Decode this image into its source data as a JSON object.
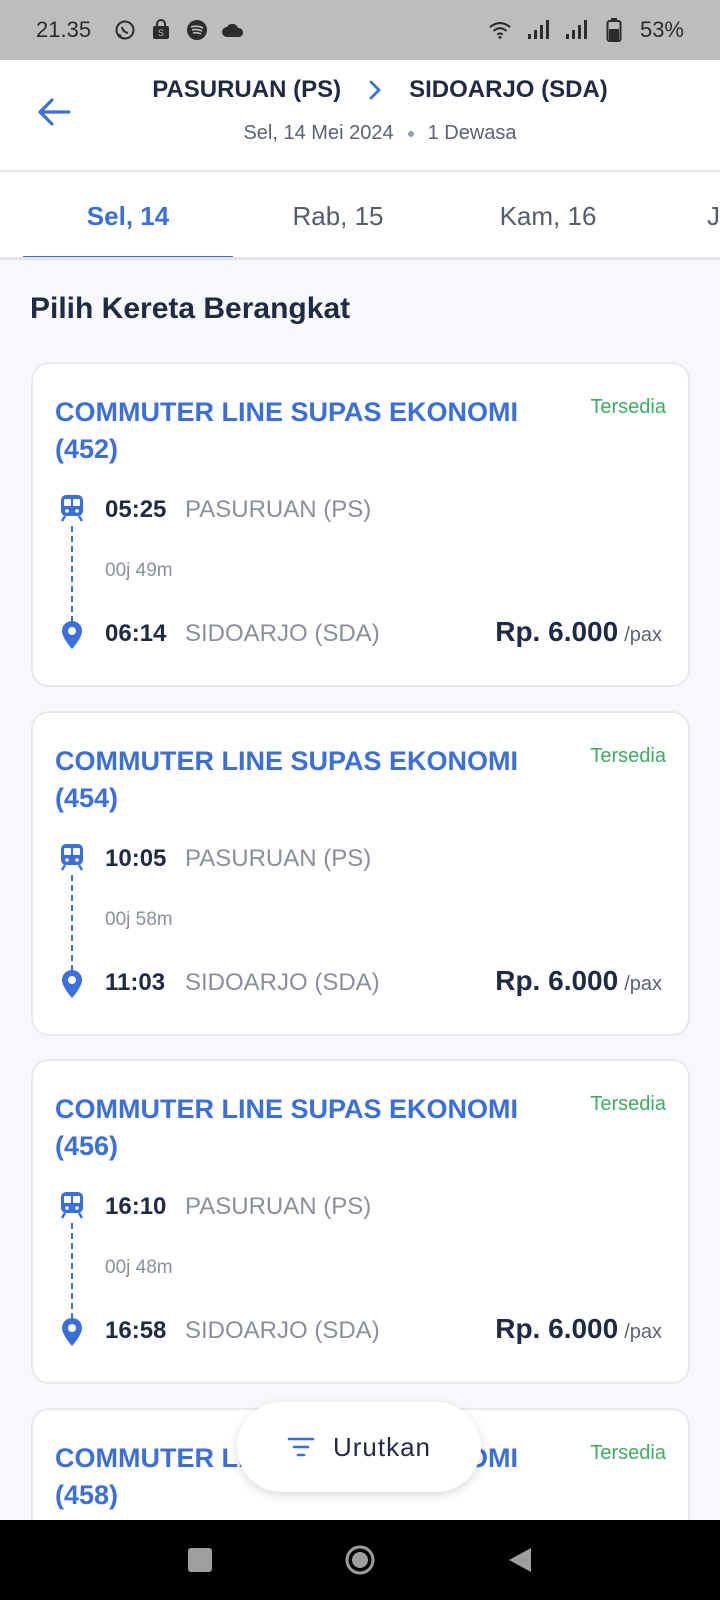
{
  "status": {
    "time": "21.35",
    "battery": "53%"
  },
  "header": {
    "origin": "PASURUAN (PS)",
    "destination": "SIDOARJO (SDA)",
    "date": "Sel, 14 Mei 2024",
    "passengers": "1 Dewasa"
  },
  "tabs": [
    {
      "label": "Sel, 14",
      "active": true
    },
    {
      "label": "Rab, 15",
      "active": false
    },
    {
      "label": "Kam, 16",
      "active": false
    },
    {
      "label": "J",
      "active": false
    }
  ],
  "section_title": "Pilih Kereta Berangkat",
  "trains": [
    {
      "name": "COMMUTER LINE SUPAS EKONOMI (452)",
      "availability": "Tersedia",
      "dep_time": "05:25",
      "dep_station": "PASURUAN (PS)",
      "duration": "00j 49m",
      "arr_time": "06:14",
      "arr_station": "SIDOARJO (SDA)",
      "price": "Rp. 6.000",
      "price_unit": "/pax"
    },
    {
      "name": "COMMUTER LINE SUPAS EKONOMI (454)",
      "availability": "Tersedia",
      "dep_time": "10:05",
      "dep_station": "PASURUAN (PS)",
      "duration": "00j 58m",
      "arr_time": "11:03",
      "arr_station": "SIDOARJO (SDA)",
      "price": "Rp. 6.000",
      "price_unit": "/pax"
    },
    {
      "name": "COMMUTER LINE SUPAS EKONOMI (456)",
      "availability": "Tersedia",
      "dep_time": "16:10",
      "dep_station": "PASURUAN (PS)",
      "duration": "00j 48m",
      "arr_time": "16:58",
      "arr_station": "SIDOARJO (SDA)",
      "price": "Rp. 6.000",
      "price_unit": "/pax"
    },
    {
      "name": "COMMUTER LINE SUPAS EKONOMI (458)",
      "availability": "Tersedia"
    }
  ],
  "sort_button": "Urutkan",
  "colors": {
    "accent": "#3a6fdc",
    "available": "#3cae5e",
    "text_dark": "#1f2a44",
    "text_muted": "#8a8f9c"
  }
}
